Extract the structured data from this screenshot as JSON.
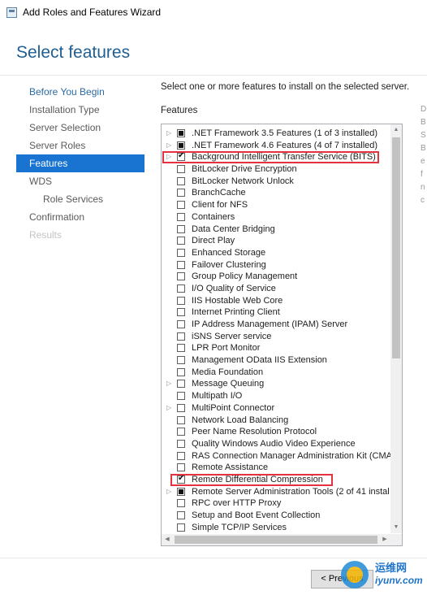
{
  "window": {
    "title": "Add Roles and Features Wizard"
  },
  "page": {
    "title": "Select features",
    "intro": "Select one or more features to install on the selected server.",
    "features_label": "Features"
  },
  "nav": {
    "items": [
      {
        "label": "Before You Begin",
        "state": "link"
      },
      {
        "label": "Installation Type",
        "state": "normal"
      },
      {
        "label": "Server Selection",
        "state": "normal"
      },
      {
        "label": "Server Roles",
        "state": "normal"
      },
      {
        "label": "Features",
        "state": "active"
      },
      {
        "label": "WDS",
        "state": "normal"
      },
      {
        "label": "Role Services",
        "state": "sub"
      },
      {
        "label": "Confirmation",
        "state": "normal"
      },
      {
        "label": "Results",
        "state": "disabled"
      }
    ]
  },
  "features": [
    {
      "label": ".NET Framework 3.5 Features (1 of 3 installed)",
      "expandable": true,
      "state": "partial"
    },
    {
      "label": ".NET Framework 4.6 Features (4 of 7 installed)",
      "expandable": true,
      "state": "partial"
    },
    {
      "label": "Background Intelligent Transfer Service (BITS)",
      "expandable": true,
      "state": "checked"
    },
    {
      "label": "BitLocker Drive Encryption",
      "expandable": false,
      "state": "unchecked"
    },
    {
      "label": "BitLocker Network Unlock",
      "expandable": false,
      "state": "unchecked"
    },
    {
      "label": "BranchCache",
      "expandable": false,
      "state": "unchecked"
    },
    {
      "label": "Client for NFS",
      "expandable": false,
      "state": "unchecked"
    },
    {
      "label": "Containers",
      "expandable": false,
      "state": "unchecked"
    },
    {
      "label": "Data Center Bridging",
      "expandable": false,
      "state": "unchecked"
    },
    {
      "label": "Direct Play",
      "expandable": false,
      "state": "unchecked"
    },
    {
      "label": "Enhanced Storage",
      "expandable": false,
      "state": "unchecked"
    },
    {
      "label": "Failover Clustering",
      "expandable": false,
      "state": "unchecked"
    },
    {
      "label": "Group Policy Management",
      "expandable": false,
      "state": "unchecked"
    },
    {
      "label": "I/O Quality of Service",
      "expandable": false,
      "state": "unchecked"
    },
    {
      "label": "IIS Hostable Web Core",
      "expandable": false,
      "state": "unchecked"
    },
    {
      "label": "Internet Printing Client",
      "expandable": false,
      "state": "unchecked"
    },
    {
      "label": "IP Address Management (IPAM) Server",
      "expandable": false,
      "state": "unchecked"
    },
    {
      "label": "iSNS Server service",
      "expandable": false,
      "state": "unchecked"
    },
    {
      "label": "LPR Port Monitor",
      "expandable": false,
      "state": "unchecked"
    },
    {
      "label": "Management OData IIS Extension",
      "expandable": false,
      "state": "unchecked"
    },
    {
      "label": "Media Foundation",
      "expandable": false,
      "state": "unchecked"
    },
    {
      "label": "Message Queuing",
      "expandable": true,
      "state": "unchecked"
    },
    {
      "label": "Multipath I/O",
      "expandable": false,
      "state": "unchecked"
    },
    {
      "label": "MultiPoint Connector",
      "expandable": true,
      "state": "unchecked"
    },
    {
      "label": "Network Load Balancing",
      "expandable": false,
      "state": "unchecked"
    },
    {
      "label": "Peer Name Resolution Protocol",
      "expandable": false,
      "state": "unchecked"
    },
    {
      "label": "Quality Windows Audio Video Experience",
      "expandable": false,
      "state": "unchecked"
    },
    {
      "label": "RAS Connection Manager Administration Kit (CMA",
      "expandable": false,
      "state": "unchecked"
    },
    {
      "label": "Remote Assistance",
      "expandable": false,
      "state": "unchecked"
    },
    {
      "label": "Remote Differential Compression",
      "expandable": false,
      "state": "checked"
    },
    {
      "label": "Remote Server Administration Tools (2 of 41 instal",
      "expandable": true,
      "state": "partial"
    },
    {
      "label": "RPC over HTTP Proxy",
      "expandable": false,
      "state": "unchecked"
    },
    {
      "label": "Setup and Boot Event Collection",
      "expandable": false,
      "state": "unchecked"
    },
    {
      "label": "Simple TCP/IP Services",
      "expandable": false,
      "state": "unchecked"
    }
  ],
  "right_panel_partial": "D\nB\nS\nB\ne\nf\nn\nc",
  "buttons": {
    "previous_label": "< Previous"
  },
  "watermark": {
    "text": "运维网",
    "sub": "iyunv.com"
  },
  "colors": {
    "accent": "#1973d1",
    "title": "#1f5f93",
    "highlight": "#e5333d"
  }
}
